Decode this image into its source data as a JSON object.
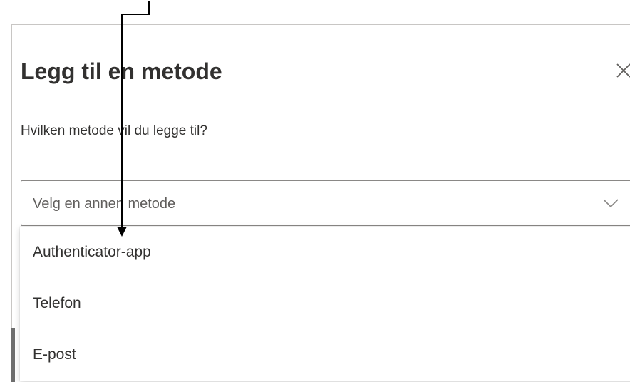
{
  "dialog": {
    "title": "Legg til en metode",
    "subtitle": "Hvilken metode vil du legge til?",
    "close_icon": "close-icon"
  },
  "select": {
    "value": "Velg en annen metode",
    "icon": "chevron-down-icon",
    "options": [
      {
        "label": "Authenticator-app"
      },
      {
        "label": "Telefon"
      },
      {
        "label": "E-post"
      }
    ]
  },
  "colors": {
    "text": "#323130",
    "placeholder": "#605e5c",
    "border": "#8a8886",
    "annotation": "#000000"
  }
}
